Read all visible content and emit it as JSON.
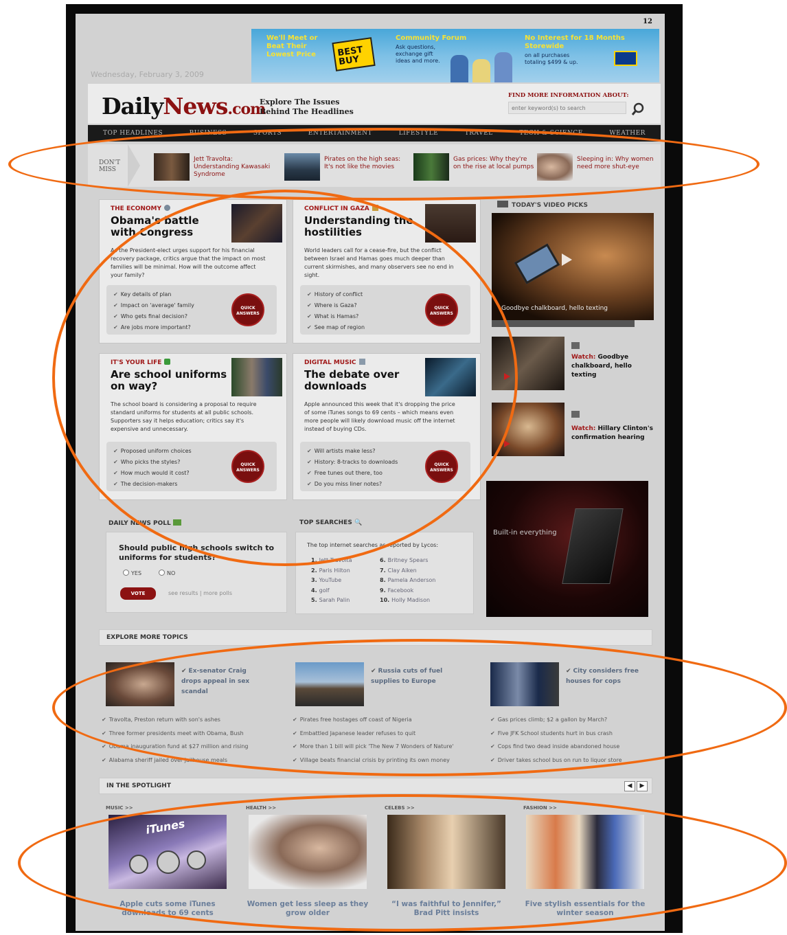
{
  "page_number": "12",
  "date": "Wednesday, February 3, 2009",
  "banner": {
    "col1": "We'll Meet or Beat Their Lowest Price",
    "logo": "BEST BUY",
    "col2_head": "Community Forum",
    "col2_sub": "Ask questions, exchange gift ideas and more.",
    "col3_head": "No Interest for 18 Months Storewide",
    "col3_sub": "on all purchases totaling $499 & up."
  },
  "site": {
    "logo_main": "Daily",
    "logo_accent": "News",
    "logo_suffix": ".com",
    "tagline_1": "Explore The Issues",
    "tagline_2": "Behind The Headlines",
    "find_more": "FIND MORE INFORMATION ABOUT:",
    "search_placeholder": "enter keyword(s) to search"
  },
  "nav": [
    "TOP HEADLINES",
    "BUSINESS",
    "SPORTS",
    "ENTERTAINMENT",
    "LIFESTYLE",
    "TRAVEL",
    "TECH & SCIENCE",
    "WEATHER"
  ],
  "dont_miss": {
    "label_1": "DON'T",
    "label_2": "MISS",
    "items": [
      "Jett Travolta: Understanding Kawasaki Syndrome",
      "Pirates on the high seas: It's not like the movies",
      "Gas prices: Why they're on the rise at local pumps",
      "Sleeping in: Why women need more shut-eye"
    ]
  },
  "cards": [
    {
      "kicker": "THE ECONOMY",
      "headline": "Obama's battle with Congress",
      "summary": "As the President-elect urges support for his financial recovery package, critics argue that the impact on most families will be minimal. How will the outcome affect your family?",
      "bullets": [
        "Key details of plan",
        "Impact on 'average' family",
        "Who gets final decision?",
        "Are jobs more important?"
      ],
      "button": "QUICK ANSWERS"
    },
    {
      "kicker": "CONFLICT IN GAZA",
      "headline": "Understanding the hostilities",
      "summary": "World leaders call for a cease-fire, but the conflict between Israel and Hamas goes much deeper than current skirmishes, and many observers see no end in sight.",
      "bullets": [
        "History of conflict",
        "Where is Gaza?",
        "What is Hamas?",
        "See map of region"
      ],
      "button": "QUICK ANSWERS"
    },
    {
      "kicker": "IT'S YOUR LIFE",
      "headline": "Are school uniforms on way?",
      "summary": "The school board is considering a proposal to require standard uniforms for students at all public schools. Supporters say it helps education; critics say it's expensive and unnecessary.",
      "bullets": [
        "Proposed uniform choices",
        "Who picks the styles?",
        "How much would it cost?",
        "The decision-makers"
      ],
      "button": "QUICK ANSWERS"
    },
    {
      "kicker": "DIGITAL MUSIC",
      "headline": "The debate over downloads",
      "summary": "Apple announced this week that it's dropping the price of some iTunes songs to 69 cents – which means even more people will likely download music off the internet instead of buying CDs.",
      "bullets": [
        "Will artists make less?",
        "History: 8-tracks to downloads",
        "Free tunes out there, too",
        "Do you miss liner notes?"
      ],
      "button": "QUICK ANSWERS"
    }
  ],
  "video": {
    "header": "TODAY'S VIDEO PICKS",
    "main_caption": "Goodbye chalkboard, hello texting",
    "side": [
      {
        "watch": "Watch:",
        "title": "Goodbye chalkboard, hello texting"
      },
      {
        "watch": "Watch:",
        "title": "Hillary Clinton's confirmation hearing"
      }
    ],
    "ad_text": "Built-in everything"
  },
  "poll": {
    "label": "DAILY NEWS POLL",
    "question": "Should public high schools switch to uniforms for students?",
    "yes": "YES",
    "no": "NO",
    "vote": "VOTE",
    "links": "see results | more polls"
  },
  "top_searches": {
    "label": "TOP SEARCHES",
    "intro": "The top internet searches as reported by Lycos:",
    "col1": [
      {
        "n": "1.",
        "t": "Jett Travolta"
      },
      {
        "n": "2.",
        "t": "Paris Hilton"
      },
      {
        "n": "3.",
        "t": "YouTube"
      },
      {
        "n": "4.",
        "t": "golf"
      },
      {
        "n": "5.",
        "t": "Sarah Palin"
      }
    ],
    "col2": [
      {
        "n": "6.",
        "t": "Britney Spears"
      },
      {
        "n": "7.",
        "t": "Clay Aiken"
      },
      {
        "n": "8.",
        "t": "Pamela Anderson"
      },
      {
        "n": "9.",
        "t": "Facebook"
      },
      {
        "n": "10.",
        "t": "Holly Madison"
      }
    ]
  },
  "explore": {
    "label": "EXPLORE MORE TOPICS",
    "features": [
      "Ex-senator Craig drops appeal in sex scandal",
      "Russia cuts of fuel supplies to Europe",
      "City considers free houses for cops"
    ],
    "col1": [
      "Travolta, Preston return with son's ashes",
      "Three former presidents meet with Obama, Bush",
      "Obama inauguration fund at $27 million and rising",
      "Alabama sheriff jailed over jailhouse meals"
    ],
    "col2": [
      "Pirates free hostages off coast of Nigeria",
      "Embattled Japanese leader refuses to quit",
      "More than 1 bill will pick 'The New 7 Wonders of Nature'",
      "Village beats financial crisis by printing its own money"
    ],
    "col3": [
      "Gas prices climb; $2 a gallon by March?",
      "Five JFK School students hurt in bus crash",
      "Cops find two dead inside abandoned house",
      "Driver takes school bus on run to liquor store"
    ]
  },
  "spotlight": {
    "label": "IN THE SPOTLIGHT",
    "prev": "◀",
    "next": "▶",
    "items": [
      {
        "cat": "MUSIC >>",
        "caption": "Apple cuts some iTunes downloads to 69 cents",
        "img_text": "iTunes"
      },
      {
        "cat": "HEALTH >>",
        "caption": "Women get less sleep as they grow older"
      },
      {
        "cat": "CELEBS >>",
        "caption": "“I was faithful to Jennifer,” Brad Pitt insists"
      },
      {
        "cat": "FASHION >>",
        "caption": "Five stylish essentials for the winter season"
      }
    ]
  },
  "colors": {
    "accent": "#8c1212",
    "highlight": "#f06a12",
    "nav": "#1a1a1a"
  }
}
